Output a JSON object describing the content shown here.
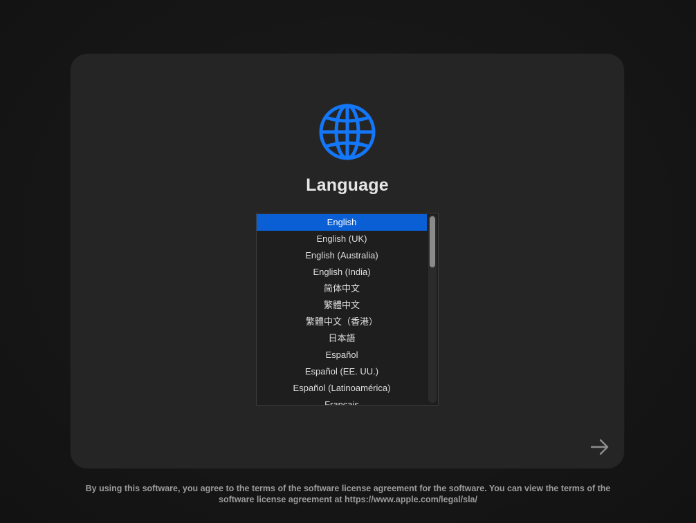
{
  "setup": {
    "title": "Language",
    "globe_icon": "globe-icon",
    "accent_color": "#0a5fd5",
    "languages": [
      "English",
      "English (UK)",
      "English (Australia)",
      "English (India)",
      "简体中文",
      "繁體中文",
      "繁體中文（香港）",
      "日本語",
      "Español",
      "Español (EE. UU.)",
      "Español (Latinoamérica)",
      "Français"
    ],
    "selected_language": "English",
    "next_icon": "arrow-right-icon"
  },
  "footer": {
    "license_text": "By using this software, you agree to the terms of the software license agreement for the software. You can view the terms of the software license agreement at https://www.apple.com/legal/sla/"
  }
}
